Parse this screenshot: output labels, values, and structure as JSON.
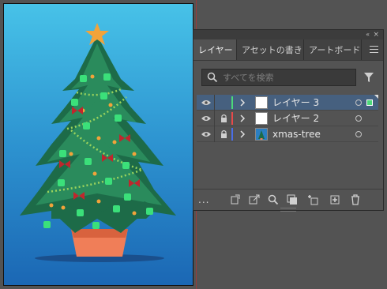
{
  "panel": {
    "tabs": [
      {
        "label": "レイヤー",
        "active": true
      },
      {
        "label": "アセットの書き",
        "active": false
      },
      {
        "label": "アートボード",
        "active": false
      }
    ],
    "search_placeholder": "すべてを検索",
    "layers": [
      {
        "name": "レイヤー 3",
        "color": "#4cd97a",
        "selected": true,
        "locked": false,
        "thumbnail": "blank"
      },
      {
        "name": "レイヤー 2",
        "color": "#e84a4a",
        "selected": false,
        "locked": true,
        "thumbnail": "blank"
      },
      {
        "name": "xmas-tree",
        "color": "#4a6ee8",
        "selected": false,
        "locked": true,
        "thumbnail": "tree"
      }
    ],
    "more_options": "...",
    "icons": [
      "collect-for-export-icon",
      "locate-object-icon",
      "search-layer-icon",
      "clipping-mask-icon",
      "new-sublayer-icon",
      "new-layer-icon",
      "delete-layer-icon"
    ]
  },
  "colors": {
    "selection_highlight": "#46607f",
    "panel_bg": "#535353",
    "artboard_top": "#47c2e8",
    "artboard_bottom": "#1b67b4"
  }
}
